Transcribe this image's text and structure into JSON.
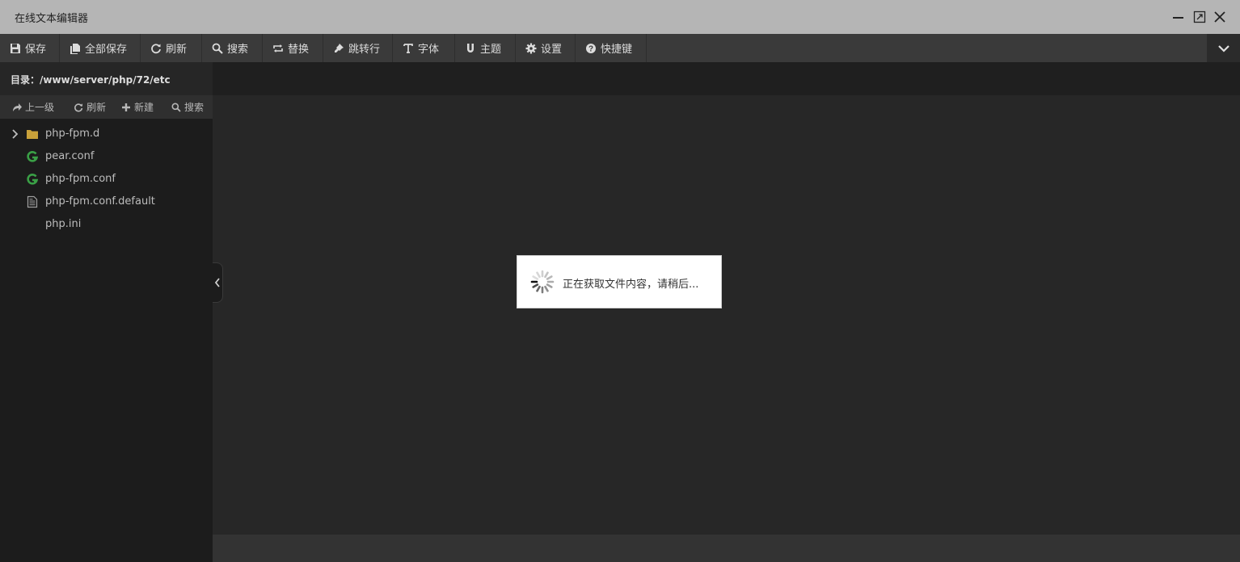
{
  "window": {
    "title": "在线文本编辑器"
  },
  "toolbar": {
    "items": [
      {
        "label": "保存",
        "icon": "save-icon"
      },
      {
        "label": "全部保存",
        "icon": "save-all-icon"
      },
      {
        "label": "刷新",
        "icon": "refresh-icon"
      },
      {
        "label": "搜索",
        "icon": "search-icon"
      },
      {
        "label": "替换",
        "icon": "replace-icon"
      },
      {
        "label": "跳转行",
        "icon": "pin-icon"
      },
      {
        "label": "字体",
        "icon": "font-icon"
      },
      {
        "label": "主题",
        "icon": "magnet-icon"
      },
      {
        "label": "设置",
        "icon": "gear-icon"
      },
      {
        "label": "快捷键",
        "icon": "help-icon"
      }
    ]
  },
  "sidebar": {
    "directory": "目录：/www/server/php/72/etc",
    "actions": [
      {
        "label": "上一级",
        "icon": "share-icon"
      },
      {
        "label": "刷新",
        "icon": "refresh-icon"
      },
      {
        "label": "新建",
        "icon": "plus-icon"
      },
      {
        "label": "搜索",
        "icon": "search-icon"
      }
    ],
    "files": [
      {
        "name": "php-fpm.d",
        "type": "folder"
      },
      {
        "name": "pear.conf",
        "type": "conf"
      },
      {
        "name": "php-fpm.conf",
        "type": "conf"
      },
      {
        "name": "php-fpm.conf.default",
        "type": "text"
      },
      {
        "name": "php.ini",
        "type": "none"
      }
    ]
  },
  "loading": {
    "message": "正在获取文件内容，请稍后..."
  },
  "colors": {
    "titlebar": "#b5b5b5",
    "toolbar": "#3a3a3a",
    "sidebar": "#1c1c1c",
    "editor": "#272727",
    "folder": "#c9a13a",
    "conf_icon": "#3aa046"
  }
}
